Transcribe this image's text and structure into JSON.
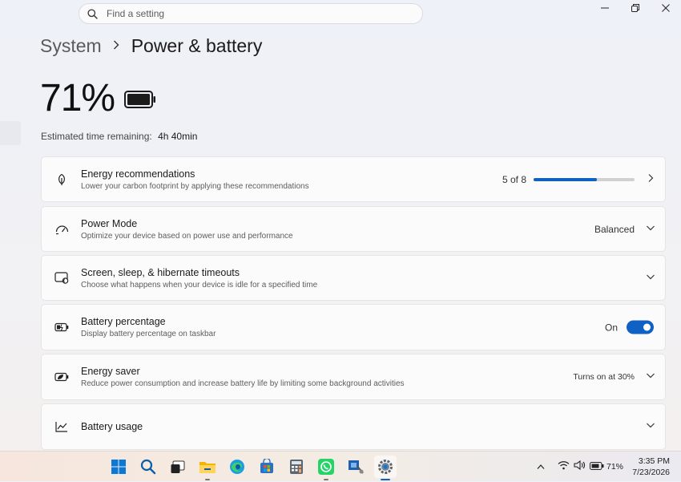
{
  "search": {
    "placeholder": "Find a setting"
  },
  "breadcrumb": {
    "parent": "System",
    "separator": "›",
    "title": "Power & battery"
  },
  "battery": {
    "percent_text": "71%",
    "estimate_label": "Estimated time remaining:",
    "estimate_value": "4h 40min"
  },
  "cards": {
    "energy_recommendations": {
      "title": "Energy recommendations",
      "subtitle": "Lower your carbon footprint by applying these recommendations",
      "progress_text": "5 of 8",
      "progress_fraction": 0.625
    },
    "power_mode": {
      "title": "Power Mode",
      "subtitle": "Optimize your device based on power use and performance",
      "value": "Balanced"
    },
    "timeouts": {
      "title": "Screen, sleep, & hibernate timeouts",
      "subtitle": "Choose what happens when your device is idle for a specified time"
    },
    "battery_percentage": {
      "title": "Battery percentage",
      "subtitle": "Display battery percentage on taskbar",
      "state": "On"
    },
    "energy_saver": {
      "title": "Energy saver",
      "subtitle": "Reduce power consumption and increase battery life by limiting some background activities",
      "value": "Turns on at 30%"
    },
    "battery_usage": {
      "title": "Battery usage"
    }
  },
  "taskbar": {
    "apps": [
      "start-icon",
      "search-icon",
      "task-view-icon",
      "file-explorer-icon",
      "edge-icon",
      "store-icon",
      "calculator-icon",
      "whatsapp-icon",
      "snipping-tool-icon",
      "settings-icon"
    ],
    "battery_text": "71%",
    "time": "3:35 PM",
    "date": "7/23/2026"
  },
  "colors": {
    "accent": "#0f62c3",
    "whatsapp": "#25d366"
  }
}
